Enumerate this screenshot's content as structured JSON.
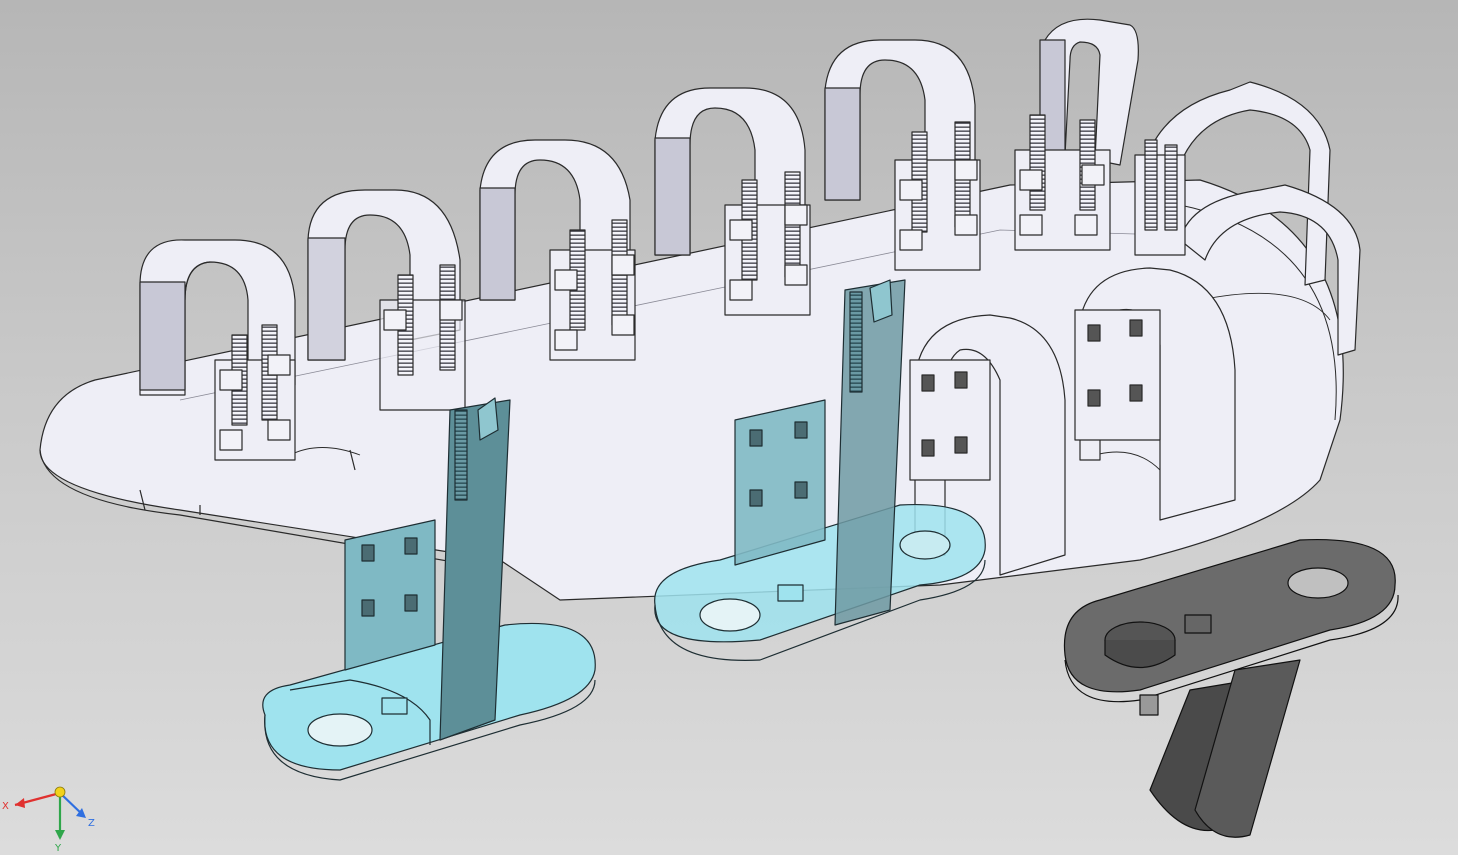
{
  "viewport": {
    "background_top": "#b6b6b6",
    "background_bottom": "#dcdcdc"
  },
  "model": {
    "chain_color": "#eeeef6",
    "edge_color": "#2a2a2a",
    "selected_color": "#9fe3ee",
    "dark_part_color": "#555555"
  },
  "triad": {
    "x_label": "X",
    "y_label": "Y",
    "z_label": "Z",
    "x_color": "#e0312f",
    "y_color": "#2fa64a",
    "z_color": "#2f6fe0",
    "origin_color": "#f2d21b"
  }
}
